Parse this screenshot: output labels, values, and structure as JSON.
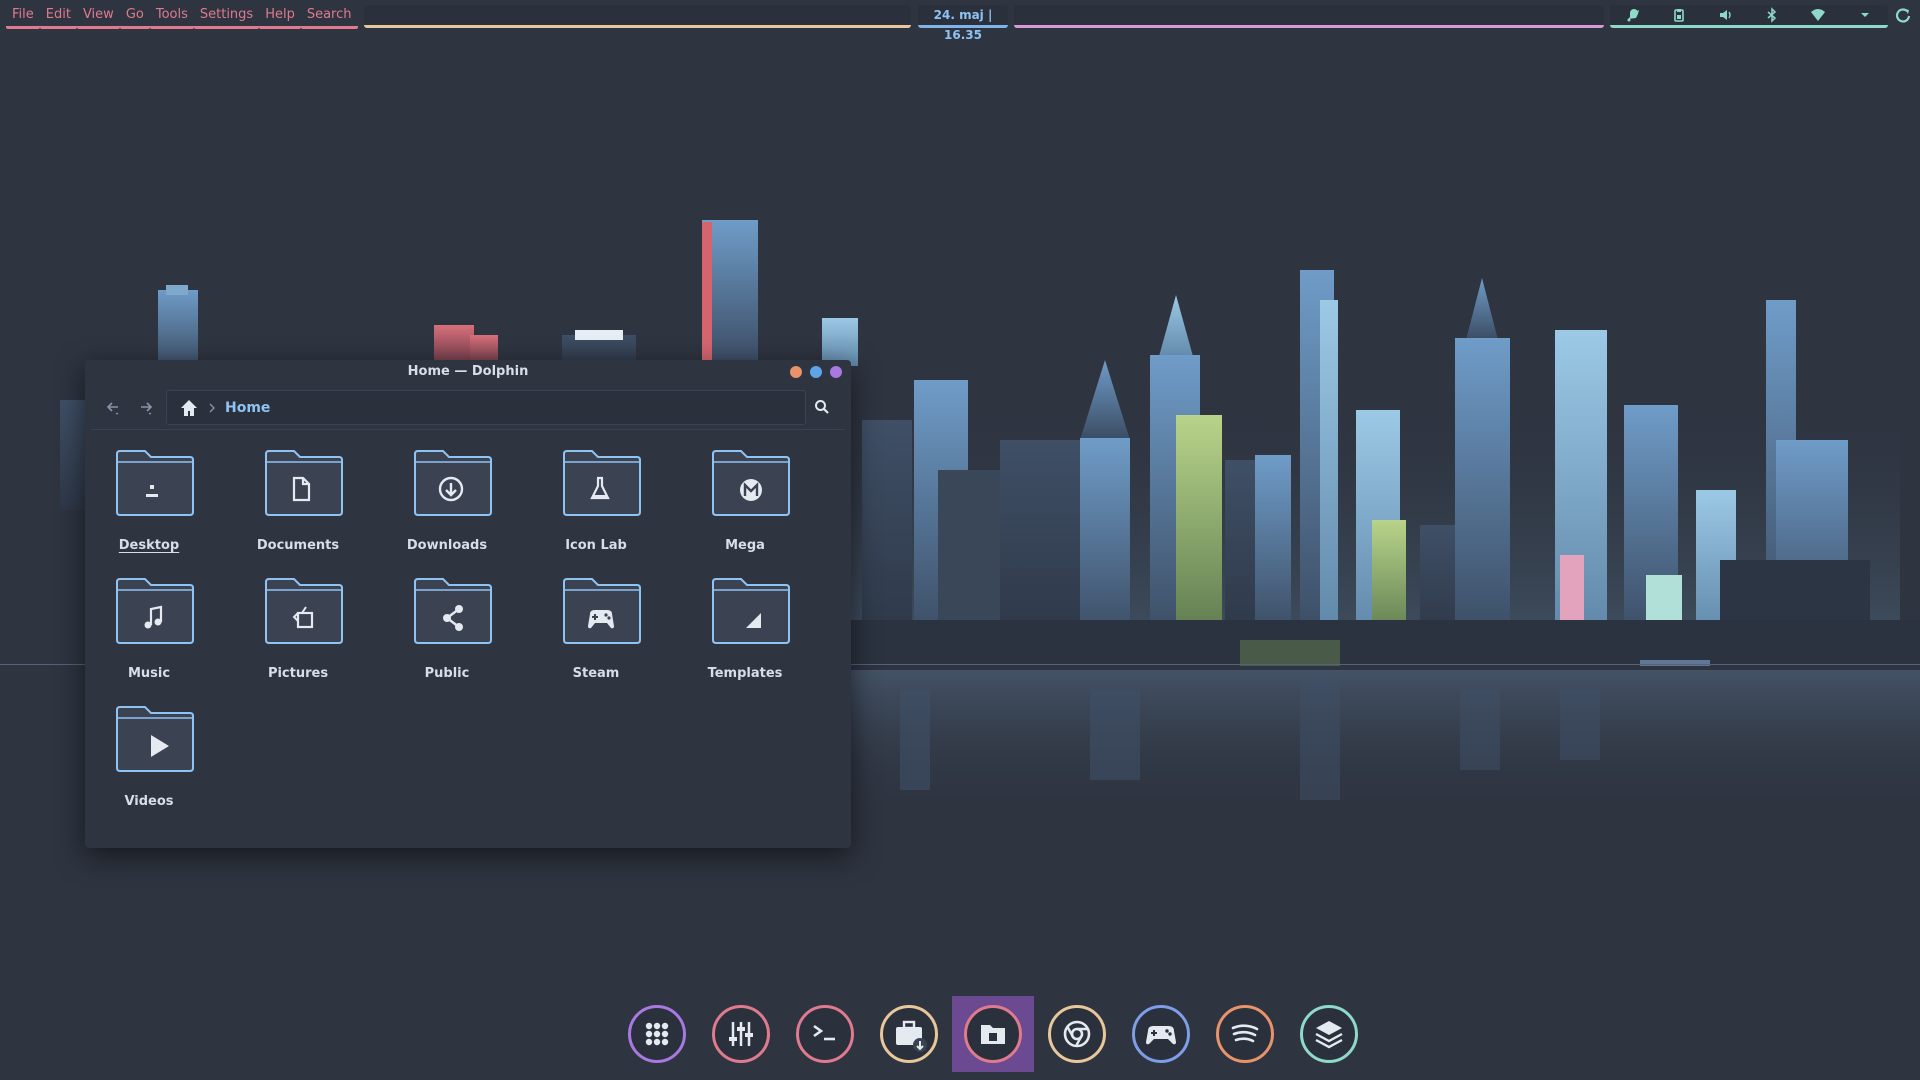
{
  "topbar": {
    "menu": [
      "File",
      "Edit",
      "View",
      "Go",
      "Tools",
      "Settings",
      "Help",
      "Search"
    ],
    "clock": "24. maj | 16.35",
    "tray_icons": [
      "bell-icon",
      "clipboard-icon",
      "volume-icon",
      "bluetooth-icon",
      "wifi-icon",
      "chevron-down-icon"
    ],
    "power_icon": "power-icon"
  },
  "window": {
    "title": "Home — Dolphin",
    "breadcrumb": "Home",
    "folders": [
      {
        "label": "Desktop",
        "icon": "desktop-folder-icon"
      },
      {
        "label": "Documents",
        "icon": "documents-folder-icon"
      },
      {
        "label": "Downloads",
        "icon": "downloads-folder-icon"
      },
      {
        "label": "Icon Lab",
        "icon": "flask-folder-icon"
      },
      {
        "label": "Mega",
        "icon": "mega-folder-icon"
      },
      {
        "label": "Music",
        "icon": "music-folder-icon"
      },
      {
        "label": "Pictures",
        "icon": "pictures-folder-icon"
      },
      {
        "label": "Public",
        "icon": "share-folder-icon"
      },
      {
        "label": "Steam",
        "icon": "gamepad-folder-icon"
      },
      {
        "label": "Templates",
        "icon": "templates-folder-icon"
      },
      {
        "label": "Videos",
        "icon": "videos-folder-icon"
      }
    ]
  },
  "dock": {
    "items": [
      {
        "name": "app-launcher",
        "icon": "grid-icon",
        "color": "#a879e0"
      },
      {
        "name": "mixer",
        "icon": "sliders-icon",
        "color": "#e07a8e"
      },
      {
        "name": "terminal",
        "icon": "terminal-icon",
        "color": "#e07a8e"
      },
      {
        "name": "software-store",
        "icon": "briefcase-download-icon",
        "color": "#e8c79a"
      },
      {
        "name": "file-manager",
        "icon": "folder-icon",
        "color": "#e07a8e",
        "active": true
      },
      {
        "name": "chrome",
        "icon": "chrome-icon",
        "color": "#e8c79a"
      },
      {
        "name": "games",
        "icon": "gamepad-icon",
        "color": "#7e9ee8"
      },
      {
        "name": "spotify",
        "icon": "spotify-icon",
        "color": "#e8936a"
      },
      {
        "name": "layers",
        "icon": "layers-icon",
        "color": "#8fd9c9"
      }
    ]
  },
  "colors": {
    "background": "#2e3440",
    "menu_accent": "#e07a8e",
    "clock_accent": "#7eb4e8",
    "tray_accent": "#8fd9c9",
    "folder_fill": "#3b4252",
    "folder_outline": "#8ec3f2"
  }
}
